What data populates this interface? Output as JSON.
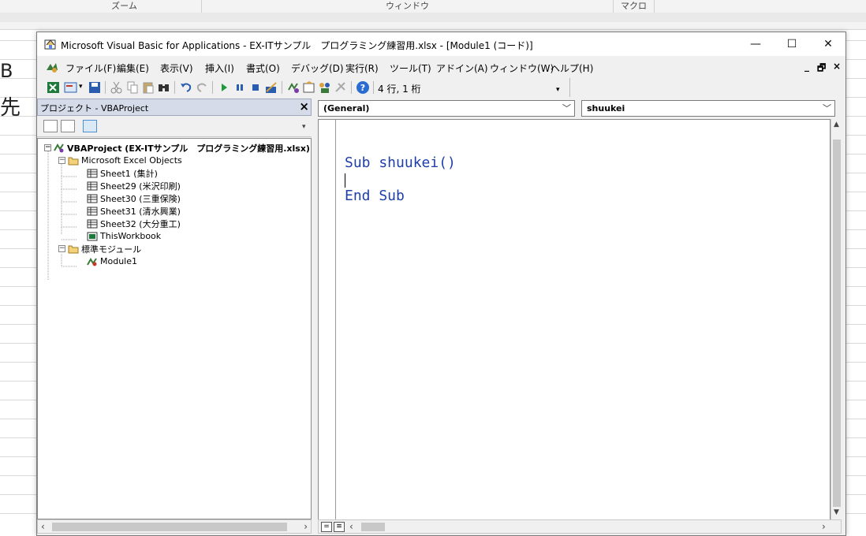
{
  "excel": {
    "ribbon_groups": [
      "ズーム",
      "ウィンドウ",
      "マクロ"
    ],
    "col_letter": "B",
    "cell_text": "先"
  },
  "vbe": {
    "title": "Microsoft Visual Basic for Applications - EX-ITサンプル　プログラミング練習用.xlsx - [Module1 (コード)]",
    "window_buttons": {
      "minimize": "—",
      "maximize": "☐",
      "close": "✕"
    },
    "menu": [
      {
        "label": "ファイル(F)"
      },
      {
        "label": "編集(E)"
      },
      {
        "label": "表示(V)"
      },
      {
        "label": "挿入(I)"
      },
      {
        "label": "書式(O)"
      },
      {
        "label": "デバッグ(D)"
      },
      {
        "label": "実行(R)"
      },
      {
        "label": "ツール(T)"
      },
      {
        "label": "アドイン(A)"
      },
      {
        "label": "ウィンドウ(W)"
      },
      {
        "label": "ヘルプ(H)"
      }
    ],
    "mdi_buttons": {
      "minimize": "_",
      "restore": "🗗",
      "close": "×"
    },
    "toolbar": {
      "cursor_position": "4 行, 1 桁"
    },
    "project": {
      "title": "プロジェクト - VBAProject",
      "close": "×",
      "tree": [
        {
          "label": "VBAProject (EX-ITサンプル　プログラミング練習用.xlsx)",
          "bold": true,
          "icon": "vbaproject-icon"
        },
        {
          "label": "Microsoft Excel Objects",
          "icon": "folder-icon"
        },
        {
          "label": "Sheet1 (集計)",
          "icon": "sheet-icon"
        },
        {
          "label": "Sheet29 (米沢印刷)",
          "icon": "sheet-icon"
        },
        {
          "label": "Sheet30 (三重保険)",
          "icon": "sheet-icon"
        },
        {
          "label": "Sheet31 (清水興業)",
          "icon": "sheet-icon"
        },
        {
          "label": "Sheet32 (大分重工)",
          "icon": "sheet-icon"
        },
        {
          "label": "ThisWorkbook",
          "icon": "workbook-icon"
        },
        {
          "label": "標準モジュール",
          "icon": "folder-icon"
        },
        {
          "label": "Module1",
          "icon": "module-icon"
        }
      ]
    },
    "code": {
      "object_combo": "(General)",
      "procedure_combo": "shuukei",
      "lines": [
        "Sub shuukei()",
        "",
        "End Sub"
      ]
    }
  }
}
